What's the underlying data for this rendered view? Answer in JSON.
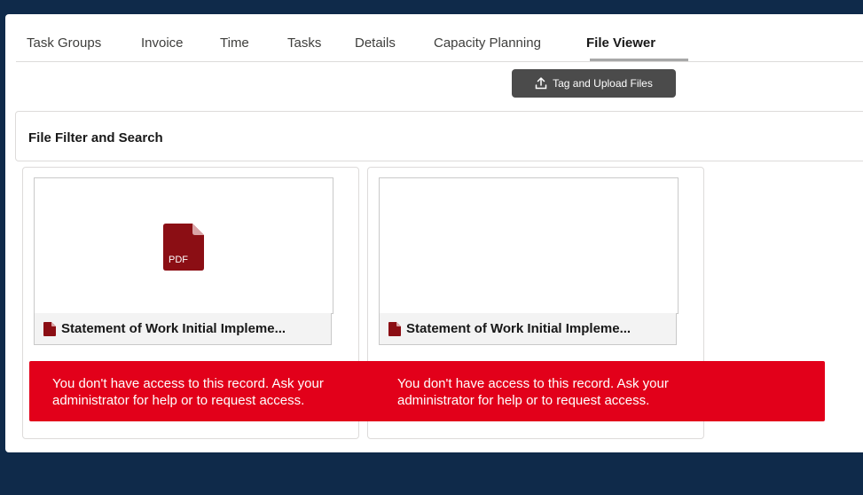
{
  "tabs": [
    {
      "label": "Task Groups"
    },
    {
      "label": "Invoice"
    },
    {
      "label": "Time"
    },
    {
      "label": "Tasks"
    },
    {
      "label": "Details"
    },
    {
      "label": "Capacity Planning"
    },
    {
      "label": "File Viewer"
    }
  ],
  "active_tab": "File Viewer",
  "toolbar": {
    "upload_label": "Tag and Upload Files",
    "upload_icon": "upload-icon"
  },
  "filter": {
    "title": "File Filter and Search"
  },
  "files": [
    {
      "name": "Statement of Work Initial Impleme...",
      "icon": "pdf-icon",
      "thumb_label": "PDF"
    },
    {
      "name": "Statement of Work Initial Impleme...",
      "icon": "pdf-icon"
    }
  ],
  "errors": [
    {
      "message": "You don't have access to this record. Ask your administrator for help or to request access."
    },
    {
      "message": "You don't have access to this record. Ask your administrator for help or to request access."
    }
  ],
  "colors": {
    "background": "#0f2a4a",
    "error": "#e2001a",
    "button": "#4b4b4b",
    "pdf": "#8b0e14"
  }
}
